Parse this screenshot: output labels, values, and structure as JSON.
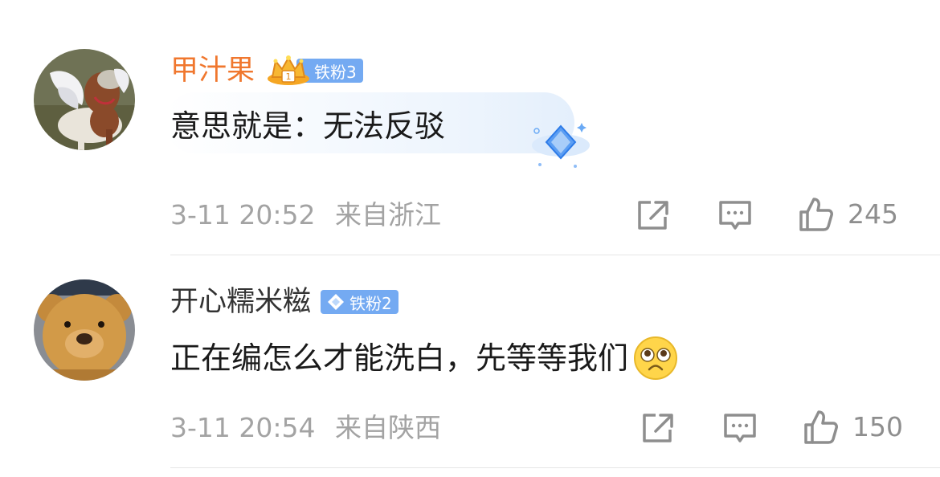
{
  "colors": {
    "vip_name": "#f0772e",
    "name": "#333333",
    "text": "#1a1a1a",
    "meta": "#a3a3a3",
    "badge": "#74aaf2",
    "divider": "#e6e6e6"
  },
  "comments": [
    {
      "username": "甲汁果",
      "badge_label": "铁粉3",
      "badge_icon": "crown-icon",
      "text": "意思就是：无法反驳",
      "timestamp": "3-11 20:52",
      "location": "来自浙江",
      "likes": "245",
      "decoration": "diamond-sparkle-bubble"
    },
    {
      "username": "开心糯米糍",
      "badge_label": "铁粉2",
      "badge_icon": "diamond-icon",
      "text": "正在编怎么才能洗白，先等等我们",
      "timestamp": "3-11 20:54",
      "location": "来自陕西",
      "likes": "150",
      "emoji": "pleading-face-emoji"
    }
  ]
}
